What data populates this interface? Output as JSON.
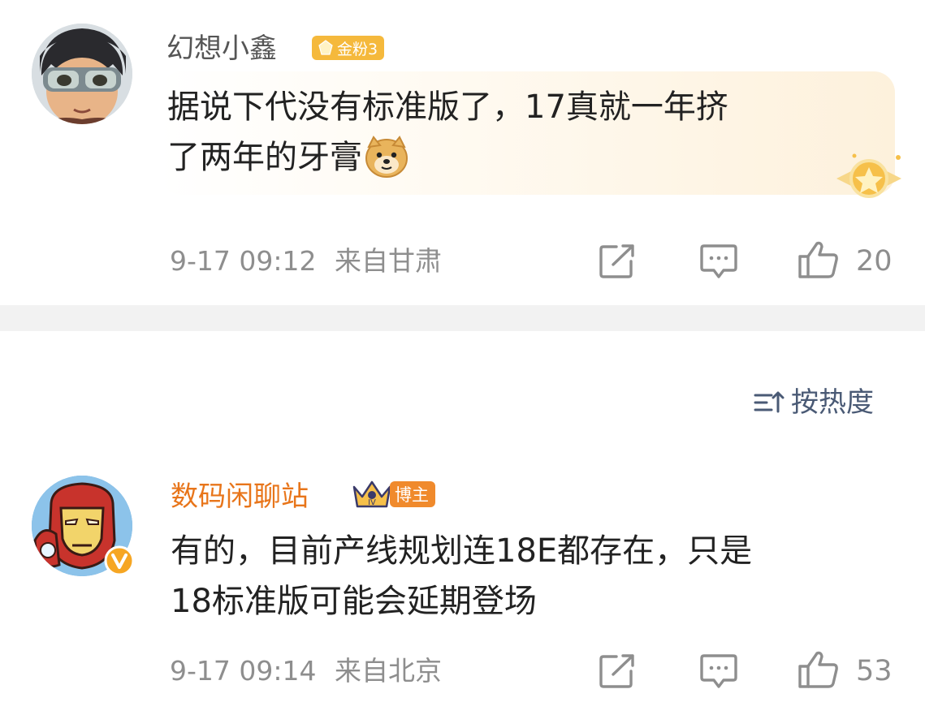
{
  "comments": [
    {
      "username": "幻想小鑫",
      "badge": "金粉3",
      "content_line1": "据说下代没有标准版了，17真就一年挤",
      "content_line2": "了两年的牙膏",
      "time": "9-17 09:12",
      "location": "来自甘肃",
      "likes": "20"
    },
    {
      "username": "数码闲聊站",
      "badge": "博主",
      "content_line1": "有的，目前产线规划连18E都存在，只是",
      "content_line2": "18标准版可能会延期登场",
      "time": "9-17 09:14",
      "location": "来自北京",
      "likes": "53"
    }
  ],
  "sort": {
    "label": "按热度"
  },
  "colors": {
    "gold_badge": "#f5b93c",
    "blogger_name": "#e8751a",
    "blogger_badge": "#f08a2c",
    "meta_gray": "#8e8e8e",
    "sort_blue": "#4a5a75",
    "divider": "#f2f2f2"
  },
  "icons": {
    "repost": "share-square-icon",
    "comment": "comment-bubble-icon",
    "like": "thumbs-up-icon",
    "sort": "sort-lines-icon",
    "emoji": "doge-emoji-icon",
    "vip": "verified-v-icon",
    "crown": "crown-icon"
  }
}
